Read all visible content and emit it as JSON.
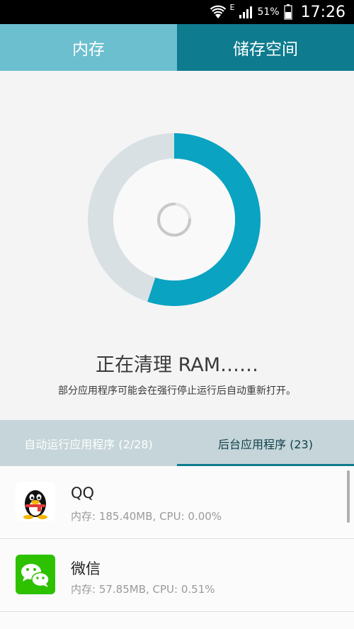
{
  "status_bar": {
    "network_type": "E",
    "battery_percent": "51%",
    "time": "17:26"
  },
  "tabs": {
    "memory": "内存",
    "storage": "储存空间"
  },
  "cleaning": {
    "used_fraction": 0.55,
    "title": "正在清理 RAM……",
    "subtitle": "部分应用程序可能会在强行停止运行后自动重新打开。"
  },
  "sub_tabs": {
    "autorun": "自动运行应用程序 (2/28)",
    "background": "后台应用程序 (23)"
  },
  "apps": [
    {
      "name": "QQ",
      "info": "内存: 185.40MB, CPU: 0.00%",
      "icon": "qq-penguin-icon"
    },
    {
      "name": "微信",
      "info": "内存: 57.85MB, CPU: 0.51%",
      "icon": "wechat-icon"
    }
  ],
  "colors": {
    "accent": "#0aa3c2",
    "tab_active": "#6cbfcf",
    "tab_inactive": "#0e7b8e",
    "ring_track": "#d9e0e3"
  }
}
